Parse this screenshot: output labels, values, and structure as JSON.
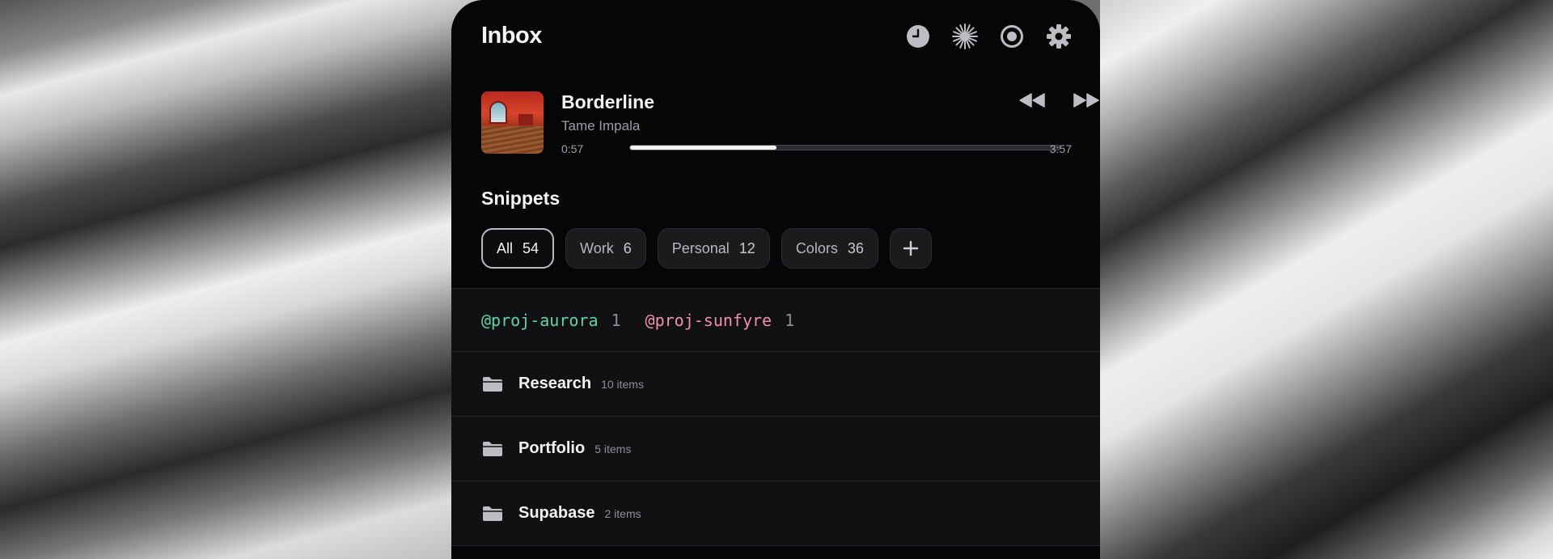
{
  "header": {
    "title": "Inbox",
    "icons": [
      "clock-icon",
      "sparkle-icon",
      "record-icon",
      "gear-icon"
    ]
  },
  "player": {
    "title": "Borderline",
    "artist": "Tame Impala",
    "current_time": "0:57",
    "total_time": "3:57",
    "progress": 0.34
  },
  "snippets": {
    "title": "Snippets",
    "chips": [
      {
        "label": "All",
        "count": "54",
        "active": true
      },
      {
        "label": "Work",
        "count": "6"
      },
      {
        "label": "Personal",
        "count": "12"
      },
      {
        "label": "Colors",
        "count": "36"
      }
    ],
    "add_label": "+"
  },
  "tags": [
    {
      "name": "@proj-aurora",
      "count": "1",
      "color": "#5fd4a6"
    },
    {
      "name": "@proj-sunfyre",
      "count": "1",
      "color": "#f08fb2"
    }
  ],
  "folders": [
    {
      "name": "Research",
      "count": "10 items"
    },
    {
      "name": "Portfolio",
      "count": "5 items"
    },
    {
      "name": "Supabase",
      "count": "2 items"
    }
  ]
}
